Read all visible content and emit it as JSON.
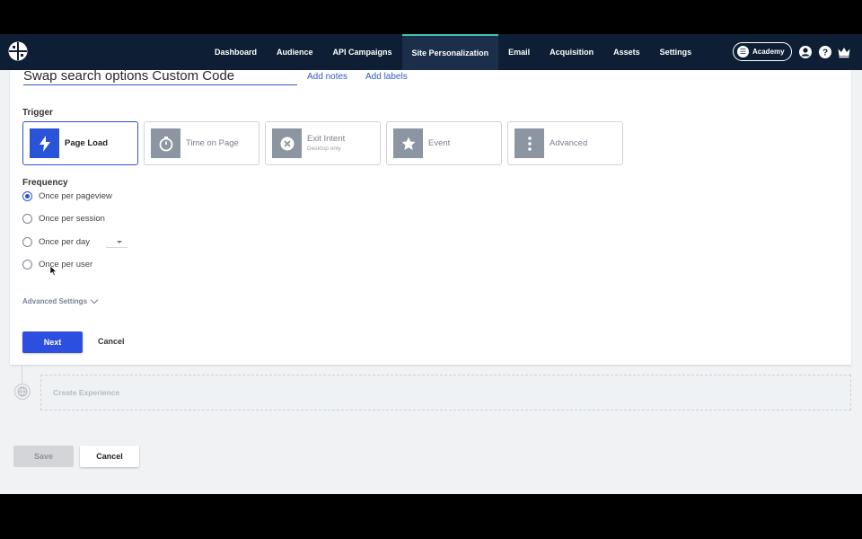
{
  "nav": {
    "items": [
      {
        "label": "Dashboard",
        "active": false
      },
      {
        "label": "Audience",
        "active": false
      },
      {
        "label": "API Campaigns",
        "active": false
      },
      {
        "label": "Site Personalization",
        "active": true
      },
      {
        "label": "Email",
        "active": false
      },
      {
        "label": "Acquisition",
        "active": false
      },
      {
        "label": "Assets",
        "active": false
      },
      {
        "label": "Settings",
        "active": false
      }
    ],
    "academy_label": "Academy",
    "icons": [
      "account-icon",
      "help-icon",
      "crown-icon"
    ]
  },
  "experience": {
    "title": "Swap search options Custom Code",
    "add_notes": "Add notes",
    "add_labels": "Add labels"
  },
  "trigger": {
    "label": "Trigger",
    "options": [
      {
        "label": "Page Load",
        "sub": "",
        "icon": "lightning-icon",
        "selected": true
      },
      {
        "label": "Time on Page",
        "sub": "",
        "icon": "stopwatch-icon",
        "selected": false
      },
      {
        "label": "Exit Intent",
        "sub": "Desktop only",
        "icon": "close-circle-icon",
        "selected": false
      },
      {
        "label": "Event",
        "sub": "",
        "icon": "star-icon",
        "selected": false
      },
      {
        "label": "Advanced",
        "sub": "",
        "icon": "more-vertical-icon",
        "selected": false
      }
    ]
  },
  "frequency": {
    "label": "Frequency",
    "options": [
      {
        "label": "Once per pageview",
        "checked": true
      },
      {
        "label": "Once per session",
        "checked": false
      },
      {
        "label": "Once per day",
        "checked": false
      },
      {
        "label": "Once per user",
        "checked": false
      }
    ]
  },
  "advanced_settings": "Advanced Settings",
  "actions": {
    "next": "Next",
    "cancel": "Cancel"
  },
  "create_experience": "Create Experience",
  "footer": {
    "save": "Save",
    "cancel": "Cancel"
  },
  "colors": {
    "nav_bg": "#0e1f35",
    "accent_blue": "#2c4fe0",
    "active_tab_border": "#3fc4b0"
  }
}
